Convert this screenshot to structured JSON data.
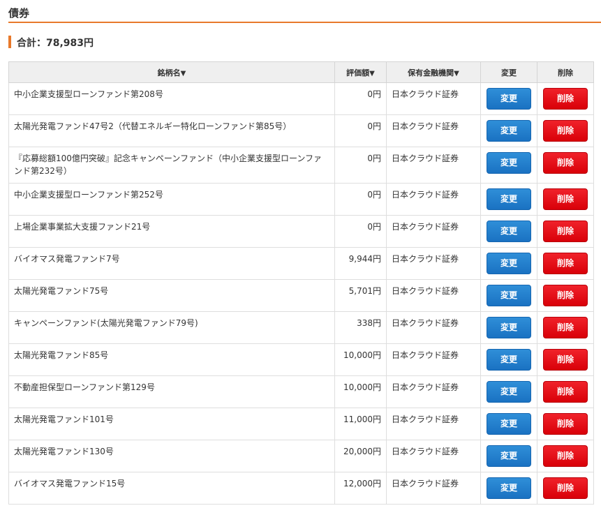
{
  "section_title": "債券",
  "total": "合計：78,983円",
  "table": {
    "headers": {
      "name": "銘柄名",
      "value": "評価額",
      "institution": "保有金融機関",
      "edit": "変更",
      "delete": "削除"
    },
    "sort_arrow": "▼",
    "rows": [
      {
        "name": "中小企業支援型ローンファンド第208号",
        "value": "0円",
        "institution": "日本クラウド証券",
        "edit": "変更",
        "delete": "削除"
      },
      {
        "name": "太陽光発電ファンド47号2（代替エネルギー特化ローンファンド第85号）",
        "value": "0円",
        "institution": "日本クラウド証券",
        "edit": "変更",
        "delete": "削除"
      },
      {
        "name": "『応募総額100億円突破』記念キャンペーンファンド（中小企業支援型ローンファンド第232号）",
        "value": "0円",
        "institution": "日本クラウド証券",
        "edit": "変更",
        "delete": "削除"
      },
      {
        "name": "中小企業支援型ローンファンド第252号",
        "value": "0円",
        "institution": "日本クラウド証券",
        "edit": "変更",
        "delete": "削除"
      },
      {
        "name": "上場企業事業拡大支援ファンド21号",
        "value": "0円",
        "institution": "日本クラウド証券",
        "edit": "変更",
        "delete": "削除"
      },
      {
        "name": "バイオマス発電ファンド7号",
        "value": "9,944円",
        "institution": "日本クラウド証券",
        "edit": "変更",
        "delete": "削除"
      },
      {
        "name": "太陽光発電ファンド75号",
        "value": "5,701円",
        "institution": "日本クラウド証券",
        "edit": "変更",
        "delete": "削除"
      },
      {
        "name": "キャンペーンファンド(太陽光発電ファンド79号)",
        "value": "338円",
        "institution": "日本クラウド証券",
        "edit": "変更",
        "delete": "削除"
      },
      {
        "name": "太陽光発電ファンド85号",
        "value": "10,000円",
        "institution": "日本クラウド証券",
        "edit": "変更",
        "delete": "削除"
      },
      {
        "name": "不動産担保型ローンファンド第129号",
        "value": "10,000円",
        "institution": "日本クラウド証券",
        "edit": "変更",
        "delete": "削除"
      },
      {
        "name": "太陽光発電ファンド101号",
        "value": "11,000円",
        "institution": "日本クラウド証券",
        "edit": "変更",
        "delete": "削除"
      },
      {
        "name": "太陽光発電ファンド130号",
        "value": "20,000円",
        "institution": "日本クラウド証券",
        "edit": "変更",
        "delete": "削除"
      },
      {
        "name": "バイオマス発電ファンド15号",
        "value": "12,000円",
        "institution": "日本クラウド証券",
        "edit": "変更",
        "delete": "削除"
      }
    ]
  },
  "colors": {
    "accent": "#e8792b",
    "edit_button": "#1a72c2",
    "delete_button": "#e00010",
    "header_bg": "#efefef"
  }
}
